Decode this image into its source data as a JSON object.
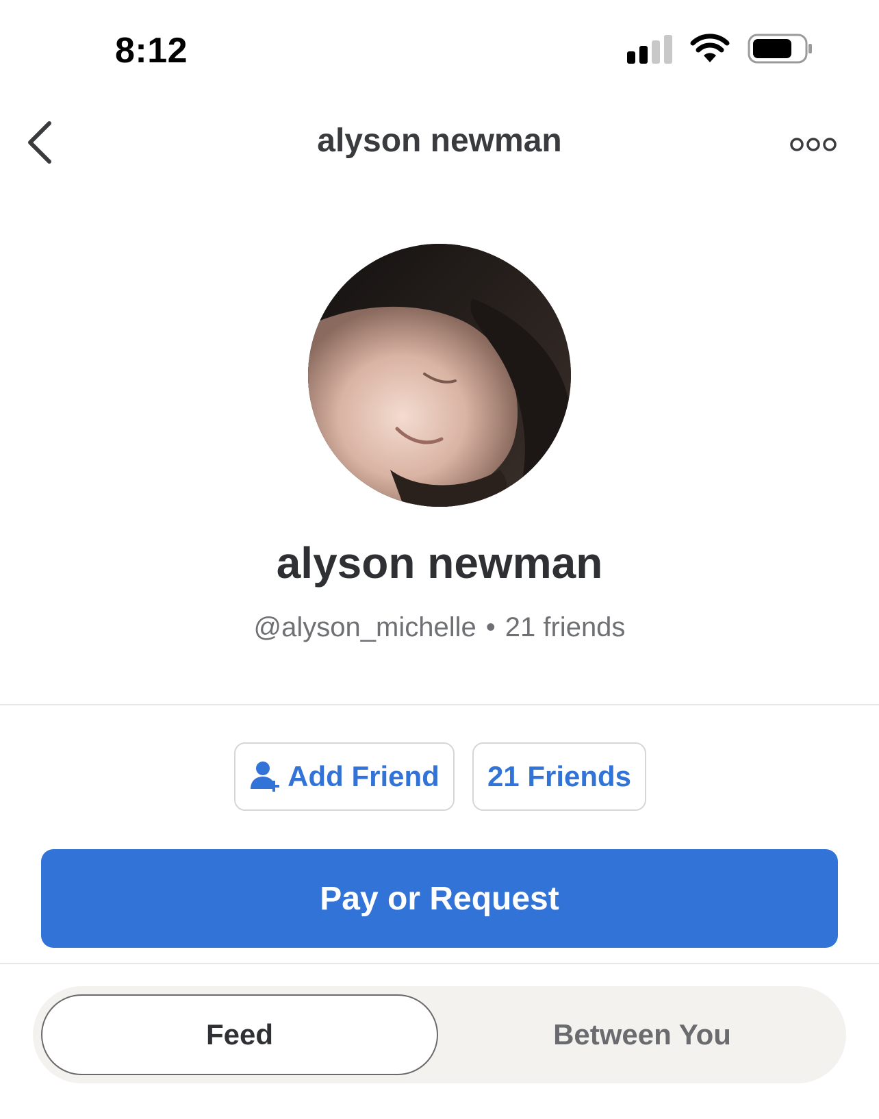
{
  "status_bar": {
    "time": "8:12"
  },
  "nav": {
    "title": "alyson newman",
    "back_icon": "chevron-left-icon",
    "more_icon": "more-dots-icon"
  },
  "profile": {
    "name": "alyson newman",
    "username": "@alyson_michelle",
    "separator": "•",
    "friends_count_text": "21 friends"
  },
  "actions": {
    "add_friend_label": "Add Friend",
    "friends_label": "21 Friends",
    "pay_label": "Pay or Request"
  },
  "tabs": [
    {
      "label": "Feed",
      "selected": true
    },
    {
      "label": "Between You",
      "selected": false
    }
  ],
  "colors": {
    "accent": "#3273d8",
    "text_primary": "#2f3033",
    "text_secondary": "#6f7074",
    "segment_bg": "#f3f2ee"
  }
}
